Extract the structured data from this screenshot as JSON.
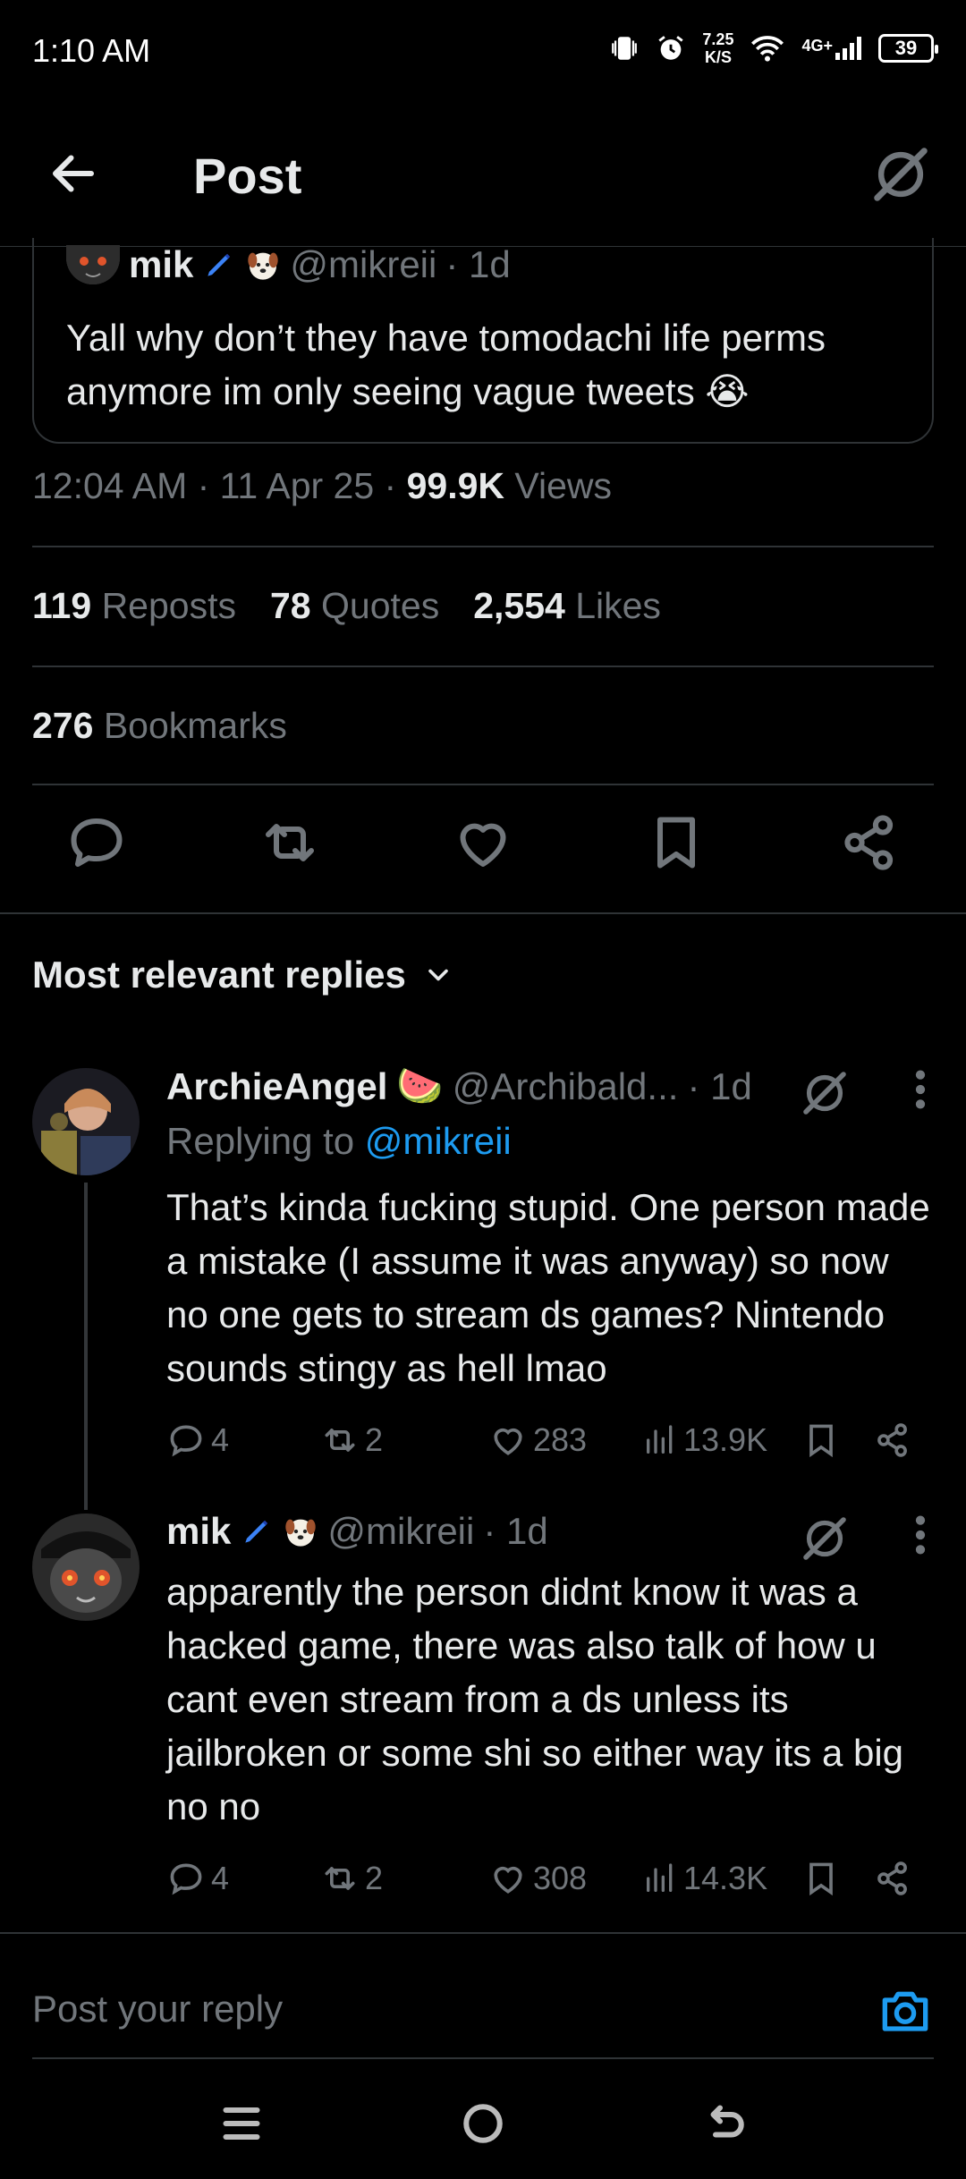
{
  "status": {
    "time": "1:10 AM",
    "net_speed_value": "7.25",
    "net_speed_unit": "K/S",
    "signal": "4G+",
    "battery": "39"
  },
  "topbar": {
    "title": "Post",
    "back_icon": "arrow-left-icon",
    "grok_icon": "grok-icon"
  },
  "quoted": {
    "name": "mik",
    "handle": "@mikreii",
    "time": "· 1d",
    "text": "Yall why don’t they have tomodachi life perms anymore im only seeing vague tweets 😭"
  },
  "post_meta": {
    "time": "12:04 AM · 11 Apr 25 · ",
    "views_count": "99.9K",
    "views_label": " Views"
  },
  "stats": {
    "reposts_count": "119",
    "reposts_label": "Reposts",
    "quotes_count": "78",
    "quotes_label": "Quotes",
    "likes_count": "2,554",
    "likes_label": "Likes",
    "bookmarks_count": "276",
    "bookmarks_label": "Bookmarks"
  },
  "actions": [
    "reply-icon",
    "repost-icon",
    "like-icon",
    "bookmark-icon",
    "share-icon"
  ],
  "replies_header": "Most relevant replies",
  "replies": [
    {
      "name": "ArchieAngel",
      "emoji": "🍉",
      "handle": "@Archibald...",
      "time": "· 1d",
      "replying_prefix": "Replying to ",
      "replying_to": "@mikreii",
      "text": "That’s kinda fucking stupid. One person made a mistake (I assume it was anyway) so now no one gets to stream ds games? Nintendo sounds stingy as hell lmao",
      "replies": "4",
      "reposts": "2",
      "likes": "283",
      "views": "13.9K"
    },
    {
      "name": "mik",
      "handle": "@mikreii",
      "time": "· 1d",
      "text": "apparently the person didnt know it was a hacked game, there was also talk of how u cant even stream from a ds unless its jailbroken or some shi so either way its a big no no",
      "replies": "4",
      "reposts": "2",
      "likes": "308",
      "views": "14.3K"
    }
  ],
  "compose": {
    "placeholder": "Post your reply"
  },
  "colors": {
    "accent": "#1d9bf0",
    "muted": "#71767b",
    "text": "#e7e9ea",
    "border": "#2f3336"
  }
}
